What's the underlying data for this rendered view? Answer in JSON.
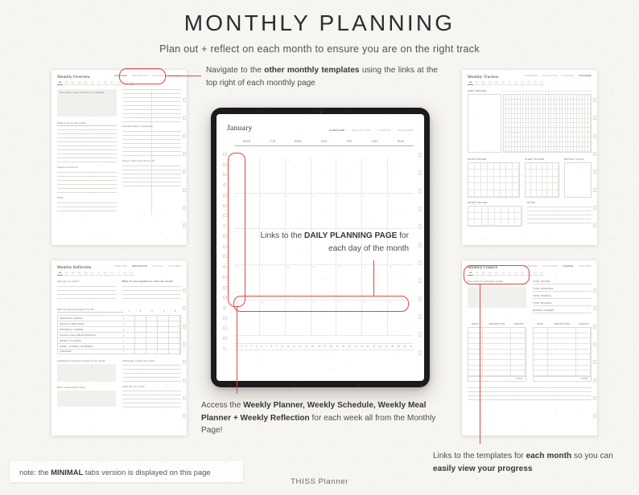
{
  "header": {
    "title": "MONTHLY PLANNING",
    "subtitle": "Plan out + reflect on each month to ensure you are on the right track"
  },
  "colors": {
    "background": "#f7f5f2",
    "accent_red": "#e0483c",
    "text": "#4f4c49",
    "heading": "#2f2d2b"
  },
  "annotations": [
    {
      "id": "nav-links",
      "text_plain": "Navigate to the other monthly templates using the links at the top right of each monthly page",
      "text_pre": "Navigate to the ",
      "text_bold": "other monthly templates",
      "text_post": " using the links at the top right of each monthly page"
    },
    {
      "id": "daily-links",
      "text_plain": "Links to the DAILY PLANNING PAGE for each day of the month",
      "text_pre": "Links to the ",
      "text_bold": "DAILY PLANNING PAGE",
      "text_post": " for each day of the month"
    },
    {
      "id": "weekly-links",
      "text_plain": "Access the Weekly Planner, Weekly Schedule, Weekly Meal Planner + Weekly Reflection for each week all from the Monthly Page!",
      "text_pre": "Access the ",
      "text_bold": "Weekly Planner, Weekly Schedule, Weekly Meal Planner + Weekly Reflection",
      "text_post": " for each week all from the Monthly Page!"
    },
    {
      "id": "month-links",
      "text_pre": "Links to the templates for ",
      "text_bold": "each month",
      "text_mid": " so you can ",
      "text_bold2": "easily view your progress",
      "text_post": ""
    }
  ],
  "tablet": {
    "page_title": "January",
    "nav_links": [
      {
        "label": "OVERVIEW",
        "active": true
      },
      {
        "label": "REFLECTION",
        "active": false
      },
      {
        "label": "FINANCE",
        "active": false
      },
      {
        "label": "TRACKERS",
        "active": false
      }
    ],
    "nav_separator": "|",
    "day_headers": [
      "MON",
      "TUE",
      "WED",
      "THU",
      "FRI",
      "SAT",
      "SUN"
    ],
    "day_strip": [
      1,
      2,
      3,
      4,
      5,
      6,
      7,
      8,
      9,
      10,
      11,
      12,
      13,
      14,
      15,
      16,
      17,
      18,
      19,
      20,
      21,
      22,
      23,
      24,
      25,
      26,
      27,
      28,
      29,
      30,
      31
    ],
    "cell_dates": [
      "",
      "",
      "",
      "",
      "",
      "",
      1,
      2,
      3,
      4,
      5,
      6,
      7,
      8,
      9,
      10,
      11,
      12,
      13,
      14,
      15,
      16,
      17,
      18,
      19,
      20,
      21,
      22,
      23,
      24,
      25,
      26,
      27,
      28,
      29,
      30,
      31,
      "",
      "",
      "",
      ""
    ]
  },
  "previews": {
    "monthly_overview": {
      "title": "Monthly Overview",
      "month_tabs": [
        "JAN",
        "FEB",
        "MAR",
        "APR",
        "MAY",
        "JUN",
        "JUL",
        "AUG",
        "SEP",
        "OCT",
        "NOV",
        "DEC"
      ],
      "active_tab": "JAN",
      "nav_links": [
        {
          "label": "OVERVIEW",
          "active": true
        },
        {
          "label": "REFLECTION",
          "active": false
        },
        {
          "label": "FINANCE",
          "active": false
        },
        {
          "label": "TRACKERS",
          "active": false
        }
      ],
      "fields": [
        "This month I want to focus on / intentions",
        "Goals to set for this month",
        "Important dates to remember",
        "Projects to work on",
        "Things I want to do this month",
        "Notes"
      ]
    },
    "monthly_reflection": {
      "title": "Monthly Reflection",
      "month_tabs": [
        "JAN",
        "FEB",
        "MAR",
        "APR",
        "MAY",
        "JUN",
        "JUL",
        "AUG",
        "SEP",
        "OCT",
        "NOV",
        "DEC"
      ],
      "active_tab": "JAN",
      "nav_links": [
        {
          "label": "OVERVIEW",
          "active": false
        },
        {
          "label": "REFLECTION",
          "active": true
        },
        {
          "label": "FINANCE",
          "active": false
        },
        {
          "label": "TRACKERS",
          "active": false
        }
      ],
      "fields": [
        "How was my month?",
        "What I'm most grateful for / wins this month",
        "Rate the following areas of my life:",
        "Highlights & standout moments of the month",
        "What I learned this month",
        "Challenges I faced this month",
        "Goals for next month"
      ],
      "rating_rows": [
        "PERSONAL GROWTH",
        "HEALTH & WELLNESS",
        "BUSINESS / CAREER",
        "SOCIAL LIFE & RELATIONSHIPS",
        "MONEY & FITNESS",
        "HOME / STUDIES / BUSINESS",
        "FINANCES"
      ],
      "rating_scale": [
        "1",
        "2",
        "3",
        "4",
        "5"
      ]
    },
    "monthly_trackers": {
      "title": "Monthly Trackers",
      "month_tabs": [
        "JAN",
        "FEB",
        "MAR",
        "APR",
        "MAY",
        "JUN",
        "JUL",
        "AUG",
        "SEP",
        "OCT",
        "NOV",
        "DEC"
      ],
      "active_tab": "JAN",
      "nav_links": [
        {
          "label": "OVERVIEW",
          "active": false
        },
        {
          "label": "REFLECTION",
          "active": false
        },
        {
          "label": "FINANCE",
          "active": false
        },
        {
          "label": "TRACKERS",
          "active": true
        }
      ],
      "habit_label": "HABIT TRACKER",
      "day_columns": [
        1,
        2,
        3,
        4,
        5,
        6,
        7,
        8,
        9,
        10,
        11,
        12,
        13,
        14,
        15,
        16,
        17,
        18,
        19,
        20,
        21,
        22,
        23,
        24,
        25,
        26,
        27,
        28,
        29,
        30,
        31
      ],
      "sub_sections": [
        "MOOD TRACKER",
        "SLEEP TRACKER",
        "WATER TRACKER",
        "MONTHLY GOALS",
        "NOTES"
      ]
    },
    "monthly_finance": {
      "title": "Monthly Finance",
      "month_tabs": [
        "JAN",
        "FEB",
        "MAR",
        "APR",
        "MAY",
        "JUN",
        "JUL",
        "AUG",
        "SEP",
        "OCT",
        "NOV",
        "DEC"
      ],
      "active_tab": "JAN",
      "nav_links": [
        {
          "label": "OVERVIEW",
          "active": false
        },
        {
          "label": "REFLECTION",
          "active": false
        },
        {
          "label": "FINANCE",
          "active": true
        },
        {
          "label": "TRACKERS",
          "active": false
        }
      ],
      "summary_fields": [
        "TOTAL INCOME",
        "TOTAL EXPENSES",
        "TOTAL SAVINGS",
        "TOTAL BALANCE",
        "MONTHLY BUDGET"
      ],
      "table_headers": [
        "DATE",
        "DESCRIPTION",
        "AMOUNT"
      ],
      "total_label": "TOTAL"
    }
  },
  "footer": {
    "note_pre": "note: the ",
    "note_bold": "MINIMAL",
    "note_post": " tabs version is displayed on this page",
    "brand": "THISS Planner"
  }
}
